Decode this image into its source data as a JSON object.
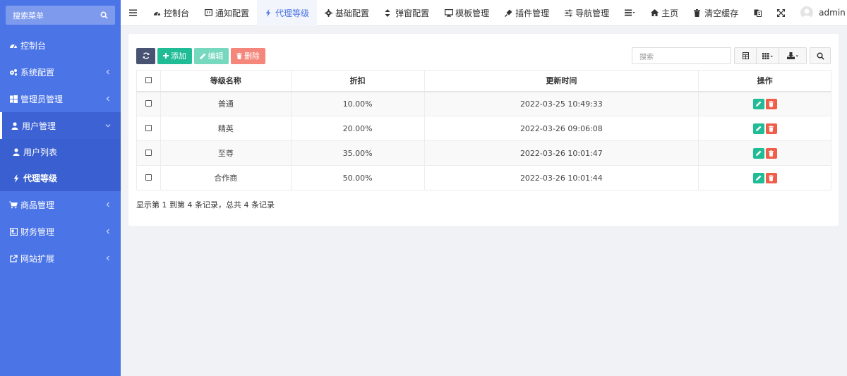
{
  "sidebar": {
    "search_placeholder": "搜索菜单",
    "items": [
      {
        "label": "控制台"
      },
      {
        "label": "系统配置"
      },
      {
        "label": "管理员管理"
      },
      {
        "label": "用户管理"
      },
      {
        "label": "商品管理"
      },
      {
        "label": "财务管理"
      },
      {
        "label": "网站扩展"
      }
    ],
    "sub_items": [
      {
        "label": "用户列表"
      },
      {
        "label": "代理等级"
      }
    ]
  },
  "topbar": {
    "tabs": [
      {
        "label": "控制台"
      },
      {
        "label": "通知配置"
      },
      {
        "label": "代理等级"
      },
      {
        "label": "基础配置"
      },
      {
        "label": "弹窗配置"
      },
      {
        "label": "模板管理"
      },
      {
        "label": "插件管理"
      },
      {
        "label": "导航管理"
      }
    ],
    "home_label": "主页",
    "clear_cache_label": "清空缓存",
    "username": "admin"
  },
  "toolbar": {
    "add_label": "添加",
    "edit_label": "编辑",
    "delete_label": "删除",
    "search_placeholder": "搜索"
  },
  "table": {
    "headers": [
      "等级名称",
      "折扣",
      "更新时间",
      "操作"
    ],
    "rows": [
      {
        "name": "普通",
        "discount": "10.00%",
        "updated": "2022-03-25 10:49:33"
      },
      {
        "name": "精英",
        "discount": "20.00%",
        "updated": "2022-03-26 09:06:08"
      },
      {
        "name": "至尊",
        "discount": "35.00%",
        "updated": "2022-03-26 10:01:47"
      },
      {
        "name": "合作商",
        "discount": "50.00%",
        "updated": "2022-03-26 10:01:44"
      }
    ]
  },
  "pagination_info": "显示第 1 到第 4 条记录，总共 4 条记录",
  "colors": {
    "sidebar": "#4b74e6",
    "accent": "#4b74e6",
    "success": "#1fbc96",
    "danger": "#f05d4b",
    "dark": "#485272"
  }
}
